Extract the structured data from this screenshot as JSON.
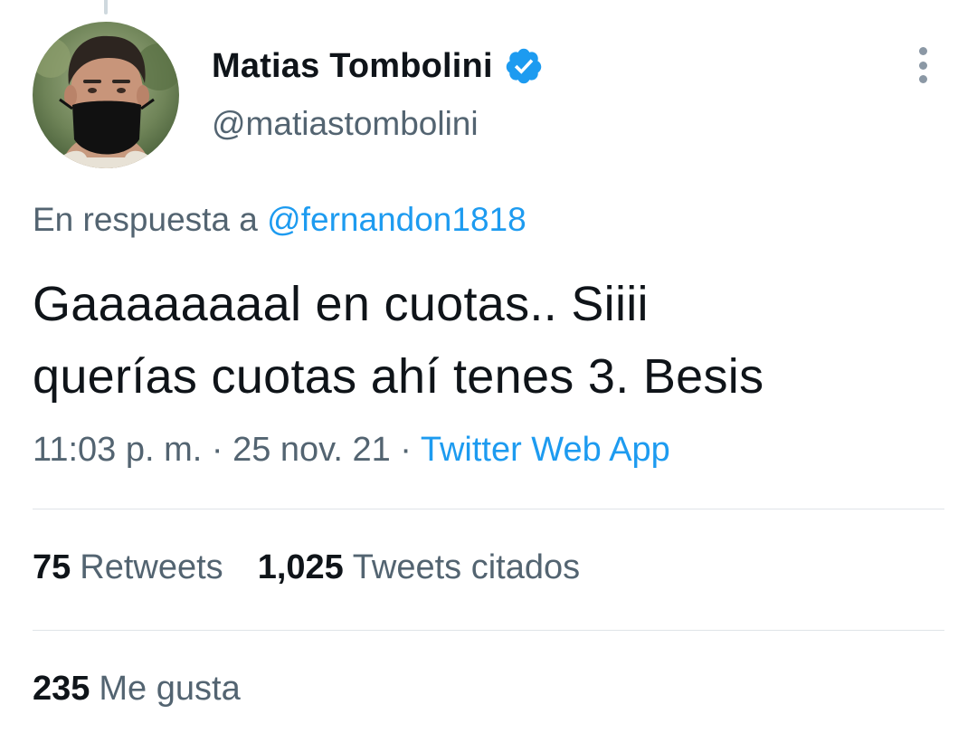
{
  "author": {
    "display_name": "Matias Tombolini",
    "handle": "@matiastombolini",
    "verified": true,
    "verified_icon": "verified-badge-icon"
  },
  "more_icon": "more-vertical-icon",
  "reply_context": {
    "prefix": "En respuesta a ",
    "mention": "@fernandon1818"
  },
  "tweet": {
    "text_lines": [
      "Gaaaaaaaal en cuotas.. Siiii",
      "querías cuotas ahí tenes 3. Besis"
    ]
  },
  "meta": {
    "time": "11:03 p. m.",
    "separator": " · ",
    "date": "25 nov. 21",
    "source": "Twitter Web App"
  },
  "stats": {
    "retweets_count": "75",
    "retweets_label": "Retweets",
    "quotes_count": "1,025",
    "quotes_label": "Tweets citados",
    "likes_count": "235",
    "likes_label": "Me gusta"
  },
  "colors": {
    "accent": "#1d9bf0",
    "text_primary": "#0f1419",
    "text_secondary": "#536471",
    "divider": "#dfe4e8"
  }
}
